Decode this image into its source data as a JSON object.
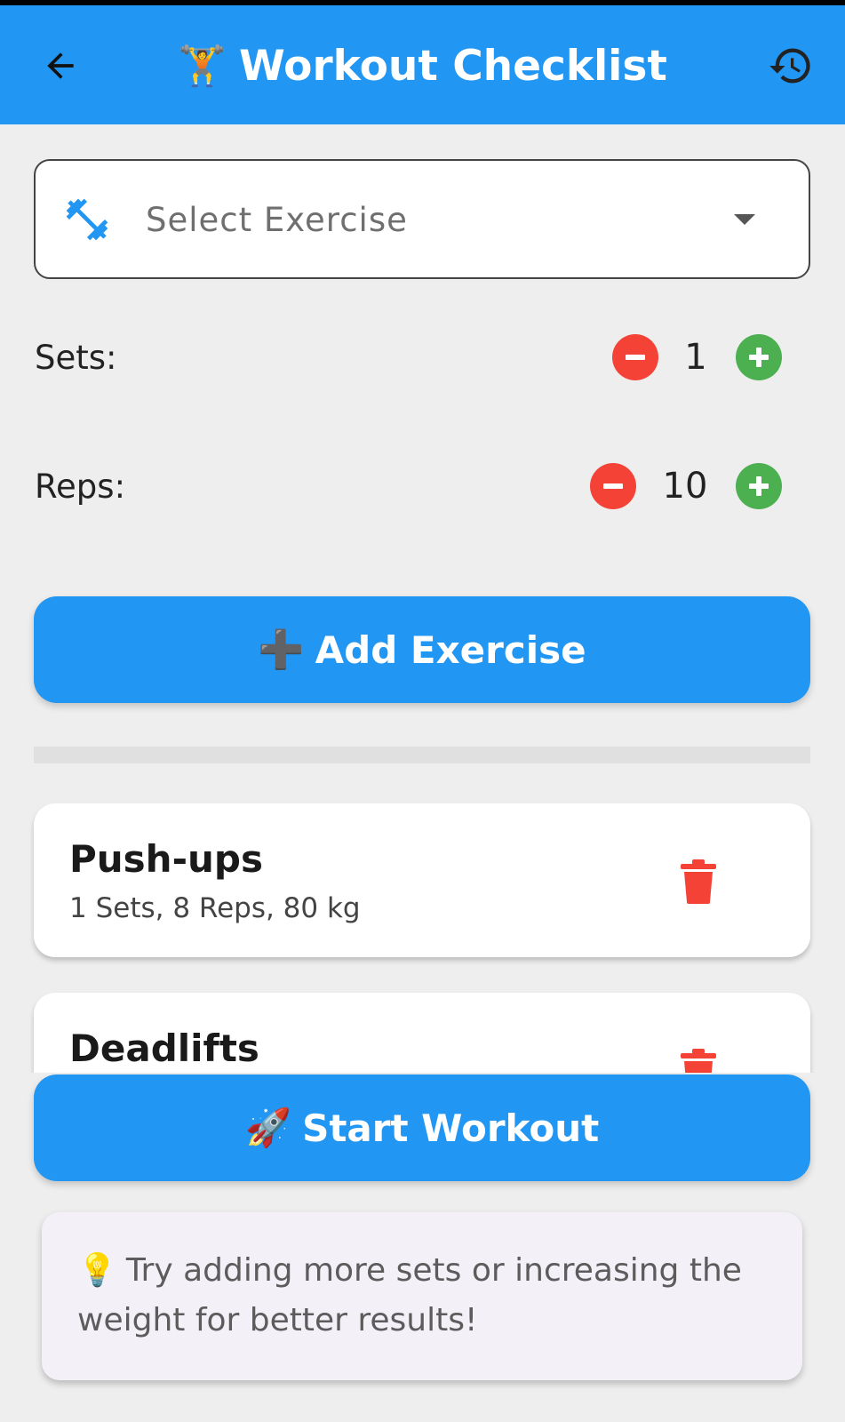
{
  "app_bar": {
    "title": "Workout Checklist",
    "title_emoji": "🏋️",
    "back_icon": "arrow-back-icon",
    "history_icon": "history-icon",
    "color": "#2196f3"
  },
  "exercise_select": {
    "placeholder": "Select Exercise",
    "icon": "dumbbell-icon",
    "caret_icon": "dropdown-caret-icon"
  },
  "sets": {
    "label": "Sets:",
    "value": "1"
  },
  "reps": {
    "label": "Reps:",
    "value": "10"
  },
  "add_button": {
    "emoji": "➕",
    "label": "Add Exercise"
  },
  "exercises": [
    {
      "name": "Push-ups",
      "detail": "1 Sets, 8 Reps, 80 kg"
    },
    {
      "name": "Deadlifts",
      "detail": ""
    }
  ],
  "start_button": {
    "emoji": "🚀",
    "label": "Start Workout"
  },
  "tip": {
    "emoji": "💡",
    "text": "Try adding more sets or increasing the weight for better results!"
  },
  "colors": {
    "primary": "#2196f3",
    "minus": "#f44336",
    "plus": "#4caf50",
    "delete": "#f44336"
  }
}
